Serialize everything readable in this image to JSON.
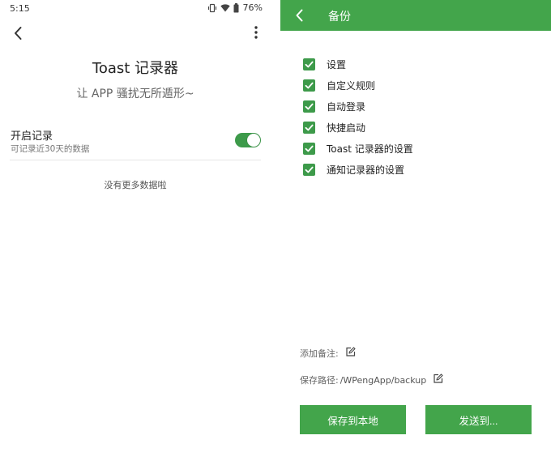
{
  "left": {
    "status": {
      "time": "5:15",
      "battery": "76%"
    },
    "title": "Toast 记录器",
    "subtitle": "让 APP 骚扰无所遁形~",
    "setting": {
      "title": "开启记录",
      "desc": "可记录近30天的数据",
      "enabled": true
    },
    "empty_text": "没有更多数据啦"
  },
  "right": {
    "header_title": "备份",
    "checklist": [
      {
        "label": "设置",
        "checked": true
      },
      {
        "label": "自定义规则",
        "checked": true
      },
      {
        "label": "自动登录",
        "checked": true
      },
      {
        "label": "快捷启动",
        "checked": true
      },
      {
        "label": "Toast 记录器的设置",
        "checked": true
      },
      {
        "label": "通知记录器的设置",
        "checked": true
      }
    ],
    "note_label": "添加备注:",
    "path_label": "保存路径:",
    "path_value": "/WPengApp/backup",
    "buttons": {
      "save_local": "保存到本地",
      "send_to": "发送到..."
    }
  },
  "colors": {
    "accent": "#43a54b",
    "toggle_on": "#3d9a4a"
  },
  "icons": [
    "back-arrow-icon",
    "more-vert-icon",
    "vibrate-icon",
    "wifi-icon",
    "battery-icon",
    "checkbox-checked-icon",
    "edit-icon"
  ]
}
